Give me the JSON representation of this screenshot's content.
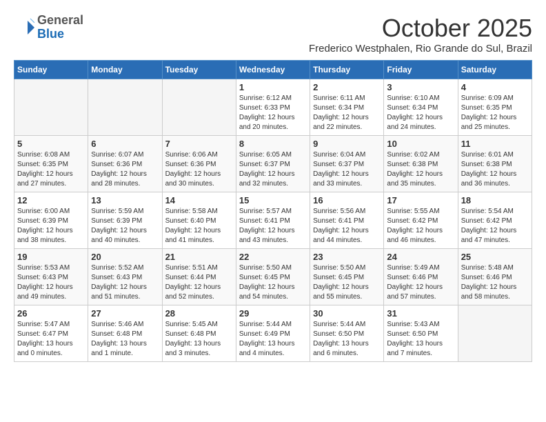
{
  "header": {
    "logo_general": "General",
    "logo_blue": "Blue",
    "title": "October 2025",
    "subtitle": "Frederico Westphalen, Rio Grande do Sul, Brazil"
  },
  "weekdays": [
    "Sunday",
    "Monday",
    "Tuesday",
    "Wednesday",
    "Thursday",
    "Friday",
    "Saturday"
  ],
  "weeks": [
    [
      {
        "day": "",
        "empty": true
      },
      {
        "day": "",
        "empty": true
      },
      {
        "day": "",
        "empty": true
      },
      {
        "day": "1",
        "sunrise": "Sunrise: 6:12 AM",
        "sunset": "Sunset: 6:33 PM",
        "daylight": "Daylight: 12 hours and 20 minutes."
      },
      {
        "day": "2",
        "sunrise": "Sunrise: 6:11 AM",
        "sunset": "Sunset: 6:34 PM",
        "daylight": "Daylight: 12 hours and 22 minutes."
      },
      {
        "day": "3",
        "sunrise": "Sunrise: 6:10 AM",
        "sunset": "Sunset: 6:34 PM",
        "daylight": "Daylight: 12 hours and 24 minutes."
      },
      {
        "day": "4",
        "sunrise": "Sunrise: 6:09 AM",
        "sunset": "Sunset: 6:35 PM",
        "daylight": "Daylight: 12 hours and 25 minutes."
      }
    ],
    [
      {
        "day": "5",
        "sunrise": "Sunrise: 6:08 AM",
        "sunset": "Sunset: 6:35 PM",
        "daylight": "Daylight: 12 hours and 27 minutes."
      },
      {
        "day": "6",
        "sunrise": "Sunrise: 6:07 AM",
        "sunset": "Sunset: 6:36 PM",
        "daylight": "Daylight: 12 hours and 28 minutes."
      },
      {
        "day": "7",
        "sunrise": "Sunrise: 6:06 AM",
        "sunset": "Sunset: 6:36 PM",
        "daylight": "Daylight: 12 hours and 30 minutes."
      },
      {
        "day": "8",
        "sunrise": "Sunrise: 6:05 AM",
        "sunset": "Sunset: 6:37 PM",
        "daylight": "Daylight: 12 hours and 32 minutes."
      },
      {
        "day": "9",
        "sunrise": "Sunrise: 6:04 AM",
        "sunset": "Sunset: 6:37 PM",
        "daylight": "Daylight: 12 hours and 33 minutes."
      },
      {
        "day": "10",
        "sunrise": "Sunrise: 6:02 AM",
        "sunset": "Sunset: 6:38 PM",
        "daylight": "Daylight: 12 hours and 35 minutes."
      },
      {
        "day": "11",
        "sunrise": "Sunrise: 6:01 AM",
        "sunset": "Sunset: 6:38 PM",
        "daylight": "Daylight: 12 hours and 36 minutes."
      }
    ],
    [
      {
        "day": "12",
        "sunrise": "Sunrise: 6:00 AM",
        "sunset": "Sunset: 6:39 PM",
        "daylight": "Daylight: 12 hours and 38 minutes."
      },
      {
        "day": "13",
        "sunrise": "Sunrise: 5:59 AM",
        "sunset": "Sunset: 6:39 PM",
        "daylight": "Daylight: 12 hours and 40 minutes."
      },
      {
        "day": "14",
        "sunrise": "Sunrise: 5:58 AM",
        "sunset": "Sunset: 6:40 PM",
        "daylight": "Daylight: 12 hours and 41 minutes."
      },
      {
        "day": "15",
        "sunrise": "Sunrise: 5:57 AM",
        "sunset": "Sunset: 6:41 PM",
        "daylight": "Daylight: 12 hours and 43 minutes."
      },
      {
        "day": "16",
        "sunrise": "Sunrise: 5:56 AM",
        "sunset": "Sunset: 6:41 PM",
        "daylight": "Daylight: 12 hours and 44 minutes."
      },
      {
        "day": "17",
        "sunrise": "Sunrise: 5:55 AM",
        "sunset": "Sunset: 6:42 PM",
        "daylight": "Daylight: 12 hours and 46 minutes."
      },
      {
        "day": "18",
        "sunrise": "Sunrise: 5:54 AM",
        "sunset": "Sunset: 6:42 PM",
        "daylight": "Daylight: 12 hours and 47 minutes."
      }
    ],
    [
      {
        "day": "19",
        "sunrise": "Sunrise: 5:53 AM",
        "sunset": "Sunset: 6:43 PM",
        "daylight": "Daylight: 12 hours and 49 minutes."
      },
      {
        "day": "20",
        "sunrise": "Sunrise: 5:52 AM",
        "sunset": "Sunset: 6:43 PM",
        "daylight": "Daylight: 12 hours and 51 minutes."
      },
      {
        "day": "21",
        "sunrise": "Sunrise: 5:51 AM",
        "sunset": "Sunset: 6:44 PM",
        "daylight": "Daylight: 12 hours and 52 minutes."
      },
      {
        "day": "22",
        "sunrise": "Sunrise: 5:50 AM",
        "sunset": "Sunset: 6:45 PM",
        "daylight": "Daylight: 12 hours and 54 minutes."
      },
      {
        "day": "23",
        "sunrise": "Sunrise: 5:50 AM",
        "sunset": "Sunset: 6:45 PM",
        "daylight": "Daylight: 12 hours and 55 minutes."
      },
      {
        "day": "24",
        "sunrise": "Sunrise: 5:49 AM",
        "sunset": "Sunset: 6:46 PM",
        "daylight": "Daylight: 12 hours and 57 minutes."
      },
      {
        "day": "25",
        "sunrise": "Sunrise: 5:48 AM",
        "sunset": "Sunset: 6:46 PM",
        "daylight": "Daylight: 12 hours and 58 minutes."
      }
    ],
    [
      {
        "day": "26",
        "sunrise": "Sunrise: 5:47 AM",
        "sunset": "Sunset: 6:47 PM",
        "daylight": "Daylight: 13 hours and 0 minutes."
      },
      {
        "day": "27",
        "sunrise": "Sunrise: 5:46 AM",
        "sunset": "Sunset: 6:48 PM",
        "daylight": "Daylight: 13 hours and 1 minute."
      },
      {
        "day": "28",
        "sunrise": "Sunrise: 5:45 AM",
        "sunset": "Sunset: 6:48 PM",
        "daylight": "Daylight: 13 hours and 3 minutes."
      },
      {
        "day": "29",
        "sunrise": "Sunrise: 5:44 AM",
        "sunset": "Sunset: 6:49 PM",
        "daylight": "Daylight: 13 hours and 4 minutes."
      },
      {
        "day": "30",
        "sunrise": "Sunrise: 5:44 AM",
        "sunset": "Sunset: 6:50 PM",
        "daylight": "Daylight: 13 hours and 6 minutes."
      },
      {
        "day": "31",
        "sunrise": "Sunrise: 5:43 AM",
        "sunset": "Sunset: 6:50 PM",
        "daylight": "Daylight: 13 hours and 7 minutes."
      },
      {
        "day": "",
        "empty": true
      }
    ]
  ]
}
